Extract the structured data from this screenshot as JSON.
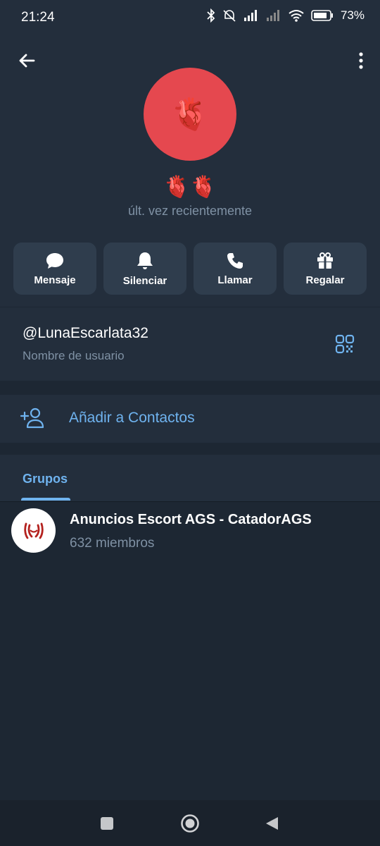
{
  "status_bar": {
    "time": "21:24",
    "battery_percent": "73%",
    "icons": [
      "bluetooth-icon",
      "mute-icon",
      "signal-icon",
      "signal-icon",
      "wifi-icon",
      "battery-icon"
    ]
  },
  "header": {
    "back_icon": "arrow-left-icon",
    "more_icon": "more-vertical-icon",
    "avatar_emoji": "🫀",
    "name": "🫀🫀",
    "last_seen": "últ. vez recientemente"
  },
  "actions": [
    {
      "label": "Mensaje",
      "icon": "chat-bubble-icon"
    },
    {
      "label": "Silenciar",
      "icon": "bell-icon"
    },
    {
      "label": "Llamar",
      "icon": "phone-icon"
    },
    {
      "label": "Regalar",
      "icon": "gift-icon"
    }
  ],
  "username": {
    "value": "@LunaEscarlata32",
    "caption": "Nombre de usuario",
    "qr_icon": "qr-code-icon"
  },
  "add_contact": {
    "label": "Añadir a Contactos",
    "icon": "add-user-icon"
  },
  "tabs": [
    {
      "label": "Grupos",
      "active": true
    }
  ],
  "groups": [
    {
      "name": "Anuncios Escort AGS - CatadorAGS",
      "members": "632 miembros"
    }
  ],
  "nav": [
    "square-icon",
    "circle-icon",
    "triangle-back-icon"
  ],
  "colors": {
    "background": "#1d2733",
    "surface": "#232e3c",
    "button": "#2f3d4d",
    "accent": "#6fb3ef",
    "avatar": "#e5484f",
    "muted_text": "#7f91a4"
  }
}
